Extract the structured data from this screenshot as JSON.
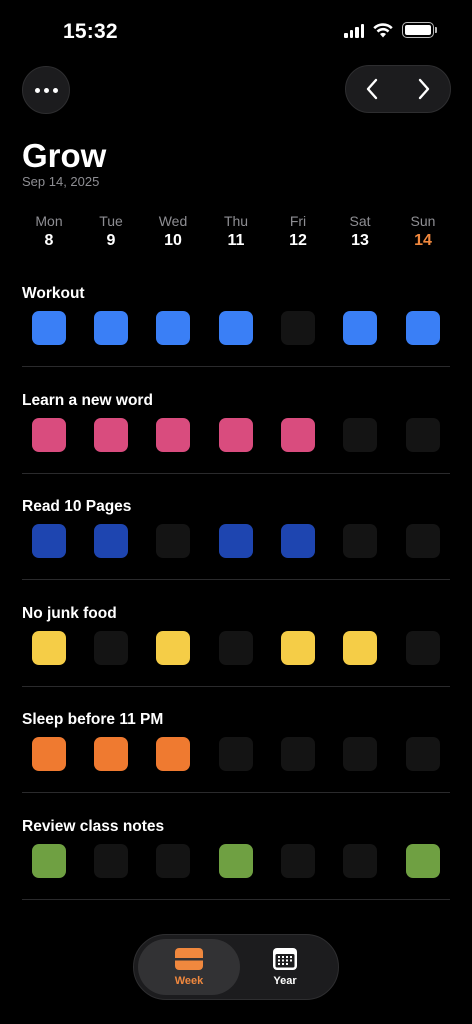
{
  "status_bar": {
    "time": "15:32"
  },
  "header": {
    "title": "Grow",
    "date": "Sep 14, 2025"
  },
  "week": [
    {
      "name": "Mon",
      "num": "8",
      "today": false
    },
    {
      "name": "Tue",
      "num": "9",
      "today": false
    },
    {
      "name": "Wed",
      "num": "10",
      "today": false
    },
    {
      "name": "Thu",
      "num": "11",
      "today": false
    },
    {
      "name": "Fri",
      "num": "12",
      "today": false
    },
    {
      "name": "Sat",
      "num": "13",
      "today": false
    },
    {
      "name": "Sun",
      "num": "14",
      "today": true
    }
  ],
  "colors": {
    "empty": "#141414",
    "today_accent": "#f0883e"
  },
  "habits": [
    {
      "name": "Workout",
      "color": "#3a7ff6",
      "days": [
        true,
        true,
        true,
        true,
        false,
        true,
        true
      ]
    },
    {
      "name": "Learn a new word",
      "color": "#d94c7e",
      "days": [
        true,
        true,
        true,
        true,
        true,
        false,
        false
      ]
    },
    {
      "name": "Read 10 Pages",
      "color": "#1e45b0",
      "days": [
        true,
        true,
        false,
        true,
        true,
        false,
        false
      ]
    },
    {
      "name": "No junk food",
      "color": "#f5cd47",
      "days": [
        true,
        false,
        true,
        false,
        true,
        true,
        false
      ]
    },
    {
      "name": "Sleep before 11 PM",
      "color": "#ef7a30",
      "days": [
        true,
        true,
        true,
        false,
        false,
        false,
        false
      ]
    },
    {
      "name": "Review class notes",
      "color": "#6fa042",
      "days": [
        true,
        false,
        false,
        true,
        false,
        false,
        true
      ]
    }
  ],
  "tabs": {
    "week_label": "Week",
    "year_label": "Year"
  }
}
